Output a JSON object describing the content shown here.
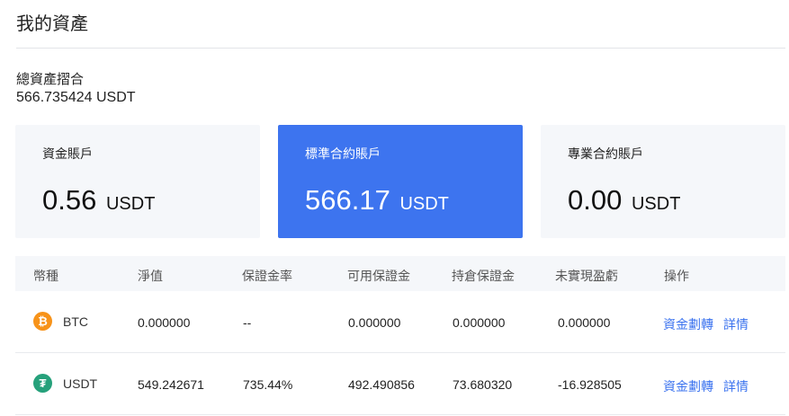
{
  "page": {
    "title": "我的資產"
  },
  "total": {
    "label": "總資產摺合",
    "value": "566.735424 USDT"
  },
  "cards": [
    {
      "title": "資金賬戶",
      "amount": "0.56",
      "unit": "USDT",
      "active": false
    },
    {
      "title": "標準合約賬戶",
      "amount": "566.17",
      "unit": "USDT",
      "active": true
    },
    {
      "title": "專業合約賬戶",
      "amount": "0.00",
      "unit": "USDT",
      "active": false
    }
  ],
  "table": {
    "headers": [
      "幣種",
      "淨值",
      "保證金率",
      "可用保證金",
      "持倉保證金",
      "未實現盈虧",
      "操作"
    ],
    "rows": [
      {
        "coin": "BTC",
        "icon": "bitcoin-icon",
        "net": "0.000000",
        "margin_rate": "--",
        "available": "0.000000",
        "position_margin": "0.000000",
        "unrealized": "0.000000",
        "action_transfer": "資金劃轉",
        "action_detail": "詳情"
      },
      {
        "coin": "USDT",
        "icon": "tether-icon",
        "net": "549.242671",
        "margin_rate": "735.44%",
        "available": "492.490856",
        "position_margin": "73.680320",
        "unrealized": "-16.928505",
        "action_transfer": "資金劃轉",
        "action_detail": "詳情"
      }
    ]
  },
  "colors": {
    "accent": "#3d74ef",
    "card_bg": "#f5f7fa",
    "btc": "#f7931a",
    "usdt": "#26a17b"
  }
}
